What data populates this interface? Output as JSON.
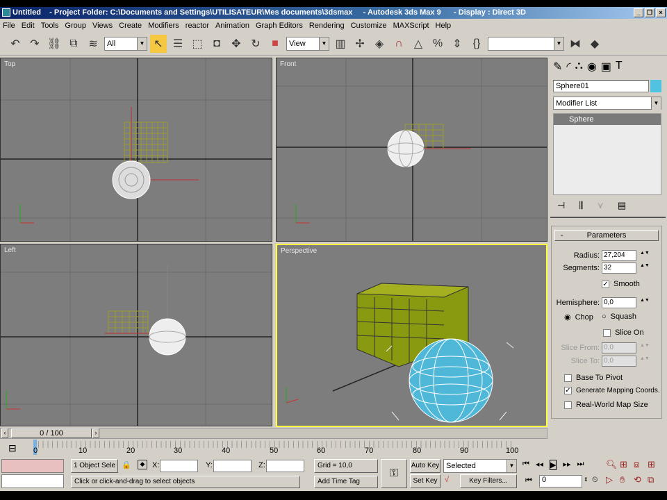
{
  "window": {
    "title": "Untitled    - Project Folder: C:\\Documents and Settings\\UTILISATEUR\\Mes documents\\3dsmax     - Autodesk 3ds Max 9      - Display : Direct 3D"
  },
  "menu": [
    "File",
    "Edit",
    "Tools",
    "Group",
    "Views",
    "Create",
    "Modifiers",
    "reactor",
    "Animation",
    "Graph Editors",
    "Rendering",
    "Customize",
    "MAXScript",
    "Help"
  ],
  "toolbar": {
    "selection_filter": "All",
    "ref_coord": "View",
    "named_selection": ""
  },
  "viewports": {
    "top": "Top",
    "front": "Front",
    "left": "Left",
    "perspective": "Perspective"
  },
  "command_panel": {
    "object_name": "Sphere01",
    "object_color": "#4fc3e0",
    "modifier_list": "Modifier List",
    "stack": [
      "Sphere"
    ],
    "rollout": "Parameters",
    "radius_label": "Radius:",
    "radius": "27,204",
    "segments_label": "Segments:",
    "segments": "32",
    "smooth": "Smooth",
    "hemisphere_label": "Hemisphere:",
    "hemisphere": "0,0",
    "chop": "Chop",
    "squash": "Squash",
    "slice_on": "Slice On",
    "slice_from_label": "Slice From:",
    "slice_from": "0,0",
    "slice_to_label": "Slice To:",
    "slice_to": "0,0",
    "base_to_pivot": "Base To Pivot",
    "gen_mapping": "Generate Mapping Coords.",
    "real_world": "Real-World Map Size"
  },
  "timeline": {
    "frame": "0 / 100",
    "ticks": [
      "0",
      "10",
      "20",
      "30",
      "40",
      "50",
      "60",
      "70",
      "80",
      "90",
      "100"
    ]
  },
  "status": {
    "selection": "1 Object Sele",
    "x_label": "X:",
    "y_label": "Y:",
    "z_label": "Z:",
    "grid": "Grid = 10,0",
    "prompt": "Click or click-and-drag to select objects",
    "add_time_tag": "Add Time Tag",
    "auto_key": "Auto Key",
    "set_key": "Set Key",
    "key_mode": "Selected",
    "key_filters": "Key Filters...",
    "current_frame": "0"
  }
}
